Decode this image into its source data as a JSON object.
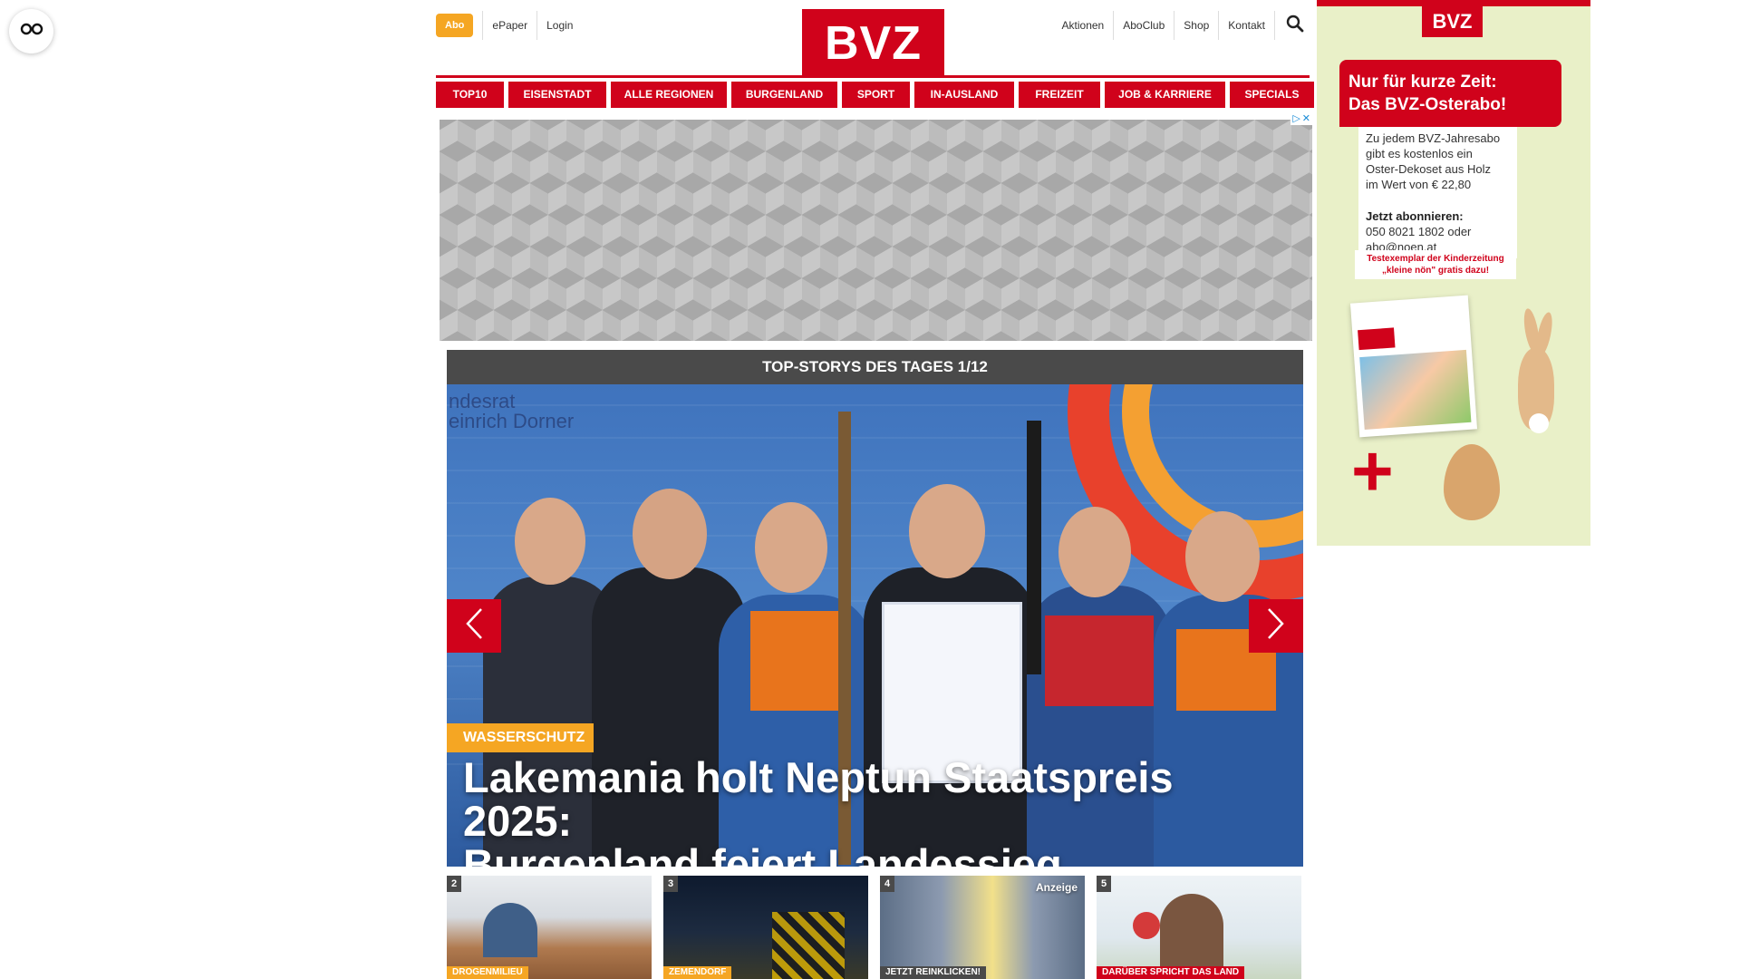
{
  "header": {
    "abo_label": "Abo",
    "left_links": [
      "ePaper",
      "Login"
    ],
    "logo_text": "BVZ",
    "right_links": [
      "Aktionen",
      "AboClub",
      "Shop",
      "Kontakt"
    ]
  },
  "nav": {
    "items": [
      "TOP10",
      "EISENSTADT",
      "ALLE REGIONEN",
      "BURGENLAND",
      "SPORT",
      "IN-AUSLAND",
      "FREIZEIT",
      "JOB & KARRIERE",
      "SPECIALS"
    ]
  },
  "ad_banner": {
    "choices_icon": "adchoices-icon",
    "close_glyph": "✕"
  },
  "top_stories": {
    "heading": "TOP-STORYS DES TAGES 1/12",
    "hero": {
      "kicker": "WASSERSCHUTZ",
      "title_line1": "Lakemania holt Neptun Staatspreis 2025:",
      "title_line2": "Burgenland feiert Landessieg",
      "wall_text": "ndesrat\neinrich Dorner"
    },
    "thumbnails": [
      {
        "number": "2",
        "tag": "DROGENMILIEU",
        "label": ""
      },
      {
        "number": "3",
        "tag": "ZEMENDORF",
        "label": ""
      },
      {
        "number": "4",
        "tag": "JETZT REINKLICKEN!",
        "label": "Anzeige"
      },
      {
        "number": "5",
        "tag": "DARÜBER SPRICHT DAS LAND",
        "label": ""
      }
    ]
  },
  "side_ad": {
    "logo_text": "BVZ",
    "headline_line1": "Nur für kurze Zeit:",
    "headline_line2": "Das BVZ-Osterabo!",
    "body_line1": "Zu jedem BVZ-Jahresabo",
    "body_line2": "gibt es kostenlos ein",
    "body_line3": "Oster-Dekoset aus Holz",
    "body_line4": "im Wert von € 22,80",
    "cta_title": "Jetzt abonnieren:",
    "cta_line1": "050 8021 1802 oder",
    "cta_line2": "abo@noen.at",
    "small_line1": "Testexemplar der Kinderzeitung",
    "small_line2": "„kleine nön\" gratis dazu!",
    "plus": "+"
  },
  "colors": {
    "brand_red": "#d0021b",
    "accent_orange": "#f5a623",
    "dark_gray": "#4a4a4a"
  }
}
